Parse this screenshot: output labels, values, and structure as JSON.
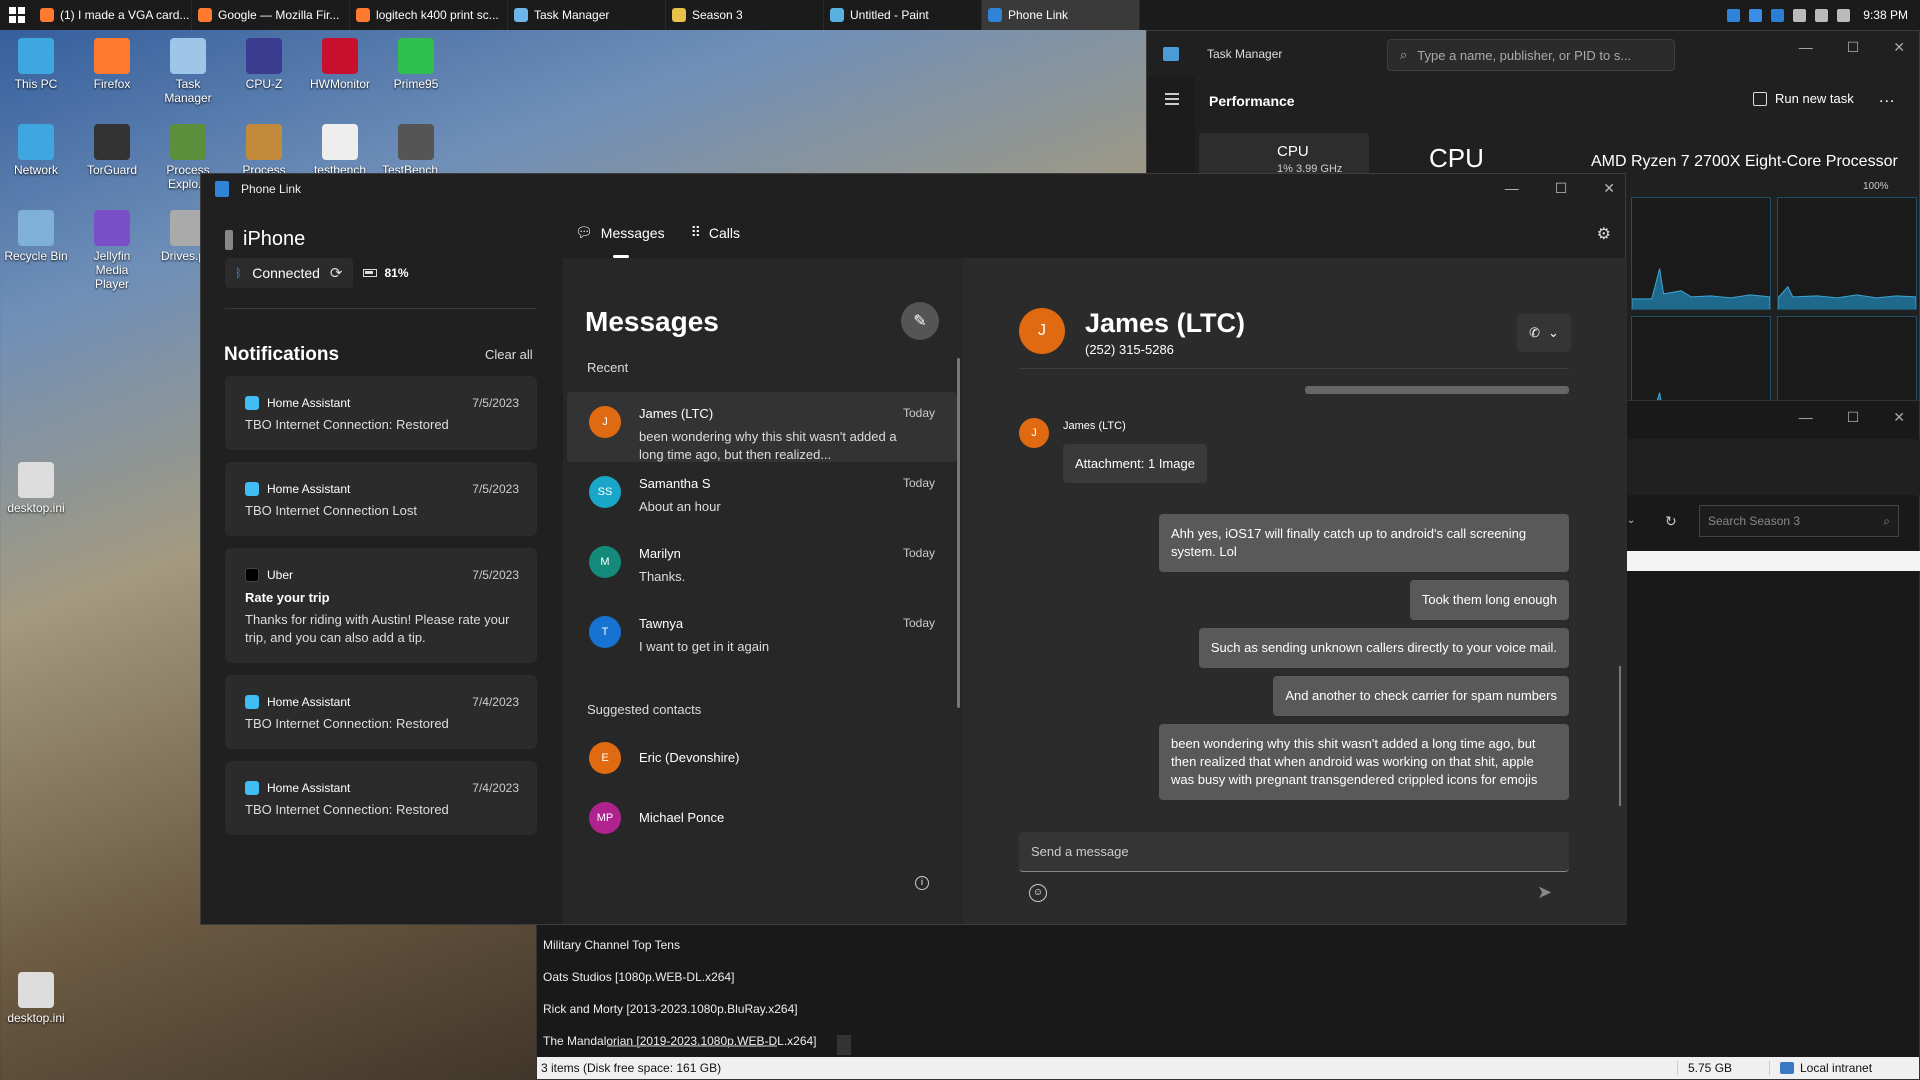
{
  "taskbar": {
    "tasks": [
      {
        "label": "(1) I made a VGA card...",
        "color": "#ff7a2e"
      },
      {
        "label": "Google — Mozilla Fir...",
        "color": "#ff7a2e"
      },
      {
        "label": "logitech k400 print sc...",
        "color": "#ff7a2e"
      },
      {
        "label": "Task Manager",
        "color": "#6fb4e8"
      },
      {
        "label": "Season 3",
        "color": "#e8c14a"
      },
      {
        "label": "Untitled - Paint",
        "color": "#5ab0e0"
      },
      {
        "label": "Phone Link",
        "color": "#2f84d8"
      }
    ],
    "clock": "9:38 PM"
  },
  "desktop": {
    "icons": [
      {
        "label": "This PC",
        "color": "#3fa7e0"
      },
      {
        "label": "Firefox",
        "color": "#ff7a2e"
      },
      {
        "label": "Task Manager",
        "color": "#9ec6e8"
      },
      {
        "label": "CPU-Z",
        "color": "#3b3b8f"
      },
      {
        "label": "HWMonitor",
        "color": "#c8102e"
      },
      {
        "label": "Prime95",
        "color": "#2fbf4f"
      },
      {
        "label": "Network",
        "color": "#3fa7e0"
      },
      {
        "label": "TorGuard",
        "color": "#333333"
      },
      {
        "label": "Process Explo...",
        "color": "#5b8f3b"
      },
      {
        "label": "Process",
        "color": "#c28a3b"
      },
      {
        "label": "testbench",
        "color": "#eeeeee"
      },
      {
        "label": "TestBench....",
        "color": "#555555"
      },
      {
        "label": "Recycle Bin",
        "color": "#7fb0d8"
      },
      {
        "label": "Jellyfin Media Player",
        "color": "#7a4fc8"
      },
      {
        "label": "Drives.p...",
        "color": "#aaaaaa"
      },
      {
        "label": "desktop.ini",
        "color": "#dddddd"
      },
      {
        "label": "desktop.ini",
        "color": "#dddddd"
      }
    ]
  },
  "taskmgr": {
    "title": "Task Manager",
    "search_placeholder": "Type a name, publisher, or PID to s...",
    "section": "Performance",
    "run_task": "Run new task",
    "more": "...",
    "cpu_label": "CPU",
    "cpu_sub": "1% 3.99 GHz",
    "cpu_heading": "CPU",
    "cpu_name": "AMD Ryzen 7 2700X Eight-Core Processor",
    "percent": "100%"
  },
  "explorer": {
    "search_placeholder": "Search Season 3",
    "items": [
      "Military Channel Top Tens",
      "Oats Studios [1080p.WEB-DL.x264]",
      "Rick and Morty [2013-2023.1080p.BluRay.x264]",
      "The Mandalorian [2019-2023.1080p.WEB-DL.x264]"
    ],
    "status_items": "3 items (Disk free space: 161 GB)",
    "status_size": "5.75 GB",
    "status_zone": "Local intranet"
  },
  "phonelink": {
    "title": "Phone Link",
    "device": "iPhone",
    "connection": "Connected",
    "battery": "81%",
    "tabs": {
      "messages": "Messages",
      "calls": "Calls"
    },
    "notifications": {
      "heading": "Notifications",
      "clear_all": "Clear all",
      "items": [
        {
          "app": "Home Assistant",
          "date": "7/5/2023",
          "title": "",
          "body": "TBO Internet Connection: Restored",
          "icon": "home"
        },
        {
          "app": "Home Assistant",
          "date": "7/5/2023",
          "title": "",
          "body": "TBO Internet Connection Lost",
          "icon": "home"
        },
        {
          "app": "Uber",
          "date": "7/5/2023",
          "title": "Rate your trip",
          "body": "Thanks for riding with Austin! Please rate your trip, and you can also add a tip.",
          "icon": "uber"
        },
        {
          "app": "Home Assistant",
          "date": "7/4/2023",
          "title": "",
          "body": "TBO Internet Connection: Restored",
          "icon": "home"
        },
        {
          "app": "Home Assistant",
          "date": "7/4/2023",
          "title": "",
          "body": "TBO Internet Connection: Restored",
          "icon": "home"
        }
      ]
    },
    "messages": {
      "heading": "Messages",
      "recent_label": "Recent",
      "conversations": [
        {
          "initials": "J",
          "name": "James (LTC)",
          "time": "Today",
          "preview": "been wondering why this shit wasn't added a long time ago, but then realized...",
          "color": "#e06a11"
        },
        {
          "initials": "SS",
          "name": "Samantha S",
          "time": "Today",
          "preview": "About an hour",
          "color": "#1aa6c8"
        },
        {
          "initials": "M",
          "name": "Marilyn",
          "time": "Today",
          "preview": "Thanks.",
          "color": "#138a7a"
        },
        {
          "initials": "T",
          "name": "Tawnya",
          "time": "Today",
          "preview": "I want to get in it again",
          "color": "#1673d1"
        }
      ],
      "suggested_label": "Suggested contacts",
      "suggested": [
        {
          "initials": "E",
          "name": "Eric (Devonshire)",
          "color": "#e06a11"
        },
        {
          "initials": "MP",
          "name": "Michael Ponce",
          "color": "#b0238f"
        }
      ]
    },
    "chat": {
      "initials": "J",
      "name": "James (LTC)",
      "number": "(252) 315-5286",
      "sender": "James (LTC)",
      "incoming": "Attachment: 1 Image",
      "outgoing": [
        "Ahh yes, iOS17 will finally catch up to android's call screening system. Lol",
        "Took them long enough",
        "Such as sending unknown callers directly to your voice mail.",
        "And another to check carrier for spam numbers",
        "been wondering why this shit wasn't added a long time ago, but then realized that when android was working on that shit, apple was busy with pregnant transgendered crippled icons for emojis"
      ],
      "input_placeholder": "Send a message"
    }
  }
}
